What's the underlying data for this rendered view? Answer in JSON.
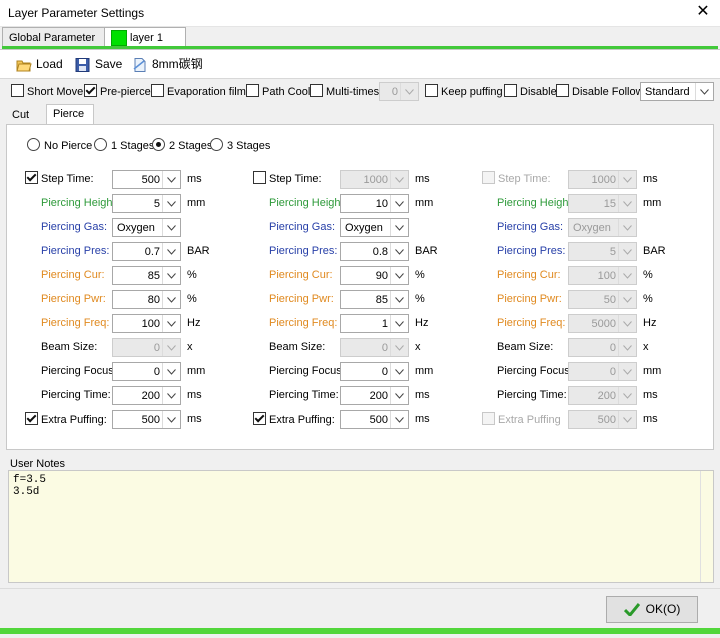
{
  "window": {
    "title": "Layer Parameter Settings"
  },
  "top_tabs": [
    {
      "label": "Global Parameter"
    },
    {
      "label": "layer 1",
      "color": "#00e000"
    }
  ],
  "toolbar": {
    "load": "Load",
    "save": "Save",
    "preset": "8mm碳钢"
  },
  "options": {
    "short_move": "Short Move",
    "pre_pierce": "Pre-pierce",
    "evaporation": "Evaporation film",
    "path_cool": "Path Cool",
    "multi_times": "Multi-times",
    "multi_times_value": "0",
    "keep_puffing": "Keep puffing",
    "disable": "Disable",
    "disable_follow": "Disable Follow",
    "mode": "Standard"
  },
  "sub_tabs": [
    "Cut",
    "Pierce"
  ],
  "stages": {
    "none": "No Pierce",
    "one": "1 Stages",
    "two": "2 Stages",
    "three": "3 Stages",
    "selected": "two"
  },
  "labels": {
    "step_time": "Step Time:",
    "height": "Piercing Height",
    "gas": "Piercing Gas:",
    "pres": "Piercing Pres:",
    "cur": "Piercing Cur:",
    "pwr": "Piercing Pwr:",
    "freq": "Piercing Freq:",
    "beam": "Beam Size:",
    "focus": "Piercing Focus:",
    "ptime": "Piercing Time:",
    "extra": "Extra Puffing:",
    "extra3": "Extra Puffing"
  },
  "units": {
    "ms": "ms",
    "mm": "mm",
    "bar": "BAR",
    "pct": "%",
    "hz": "Hz",
    "x": "x"
  },
  "columns": [
    {
      "step_time": "500",
      "height": "5",
      "gas": "Oxygen",
      "pres": "0.7",
      "cur": "85",
      "pwr": "80",
      "freq": "100",
      "beam": "0",
      "focus": "0",
      "ptime": "200",
      "extra": "500"
    },
    {
      "step_time": "1000",
      "height": "10",
      "gas": "Oxygen",
      "pres": "0.8",
      "cur": "90",
      "pwr": "85",
      "freq": "1",
      "beam": "0",
      "focus": "0",
      "ptime": "200",
      "extra": "500"
    },
    {
      "step_time": "1000",
      "height": "15",
      "gas": "Oxygen",
      "pres": "5",
      "cur": "100",
      "pwr": "50",
      "freq": "5000",
      "beam": "0",
      "focus": "0",
      "ptime": "200",
      "extra": "500"
    }
  ],
  "notes": {
    "label": "User Notes",
    "text": "f=3.5\n3.5d"
  },
  "ok": "OK(O)"
}
